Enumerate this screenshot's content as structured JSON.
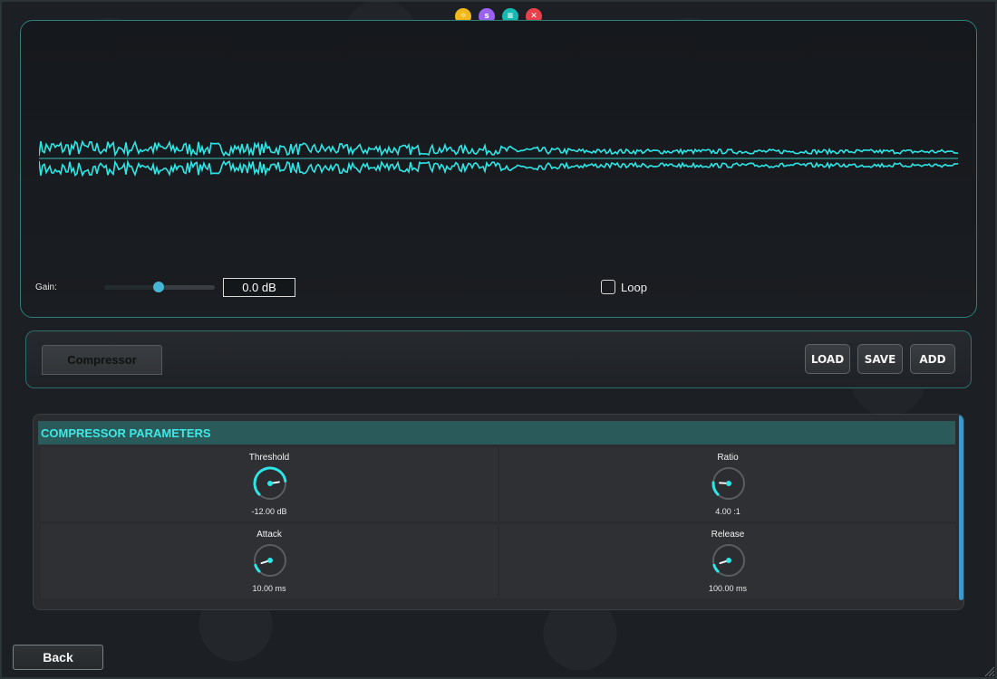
{
  "top_icons": [
    {
      "name": "sun-icon",
      "glyph": "☼",
      "color": "#f1b81b"
    },
    {
      "name": "s-icon",
      "glyph": "s",
      "color": "#9b61f0"
    },
    {
      "name": "menu-icon",
      "glyph": "≡",
      "color": "#15b9b2"
    },
    {
      "name": "close-icon",
      "glyph": "✕",
      "color": "#e8414b"
    }
  ],
  "waveform": {
    "color": "#2ee6e6"
  },
  "transport": {
    "gain_label": "Gain:",
    "gain_value": "0.0 dB",
    "gain_fraction": 0.5,
    "loop_label": "Loop",
    "loop_checked": false
  },
  "effects_bar": {
    "tab_label": "Compressor",
    "load_label": "LOAD",
    "save_label": "SAVE",
    "add_label": "ADD"
  },
  "parameters": {
    "header": "COMPRESSOR PARAMETERS",
    "items": [
      {
        "name": "Threshold",
        "value": "-12.00 dB",
        "level": 0.8
      },
      {
        "name": "Ratio",
        "value": "4.00 :1",
        "level": 0.18
      },
      {
        "name": "Attack",
        "value": "10.00 ms",
        "level": 0.1
      },
      {
        "name": "Release",
        "value": "100.00 ms",
        "level": 0.1
      }
    ]
  },
  "back_label": "Back",
  "accent": "#2ee6e6"
}
